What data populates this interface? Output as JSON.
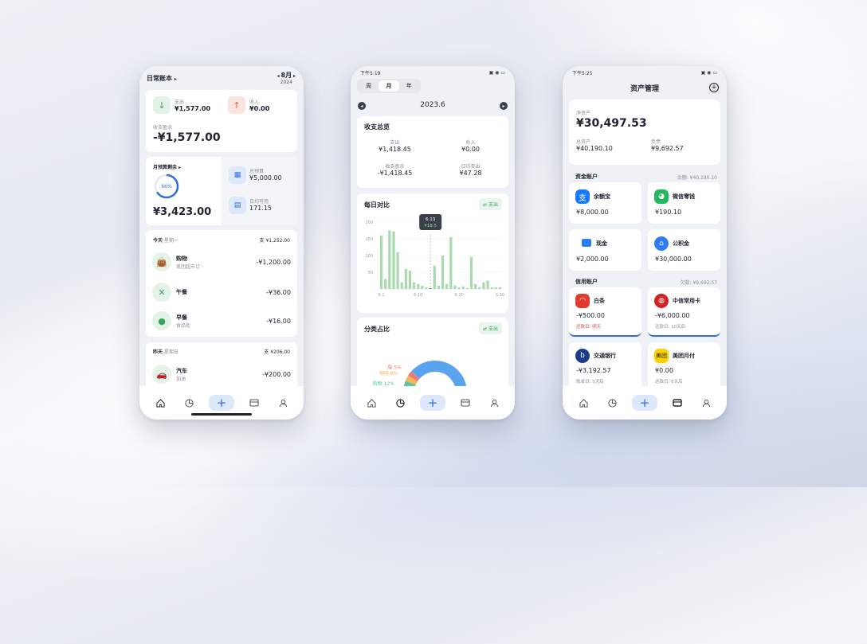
{
  "phone1": {
    "title": "日常账本",
    "month": "8月",
    "year": "2024",
    "expense_label": "支出",
    "expense": "¥1,577.00",
    "income_label": "收入",
    "income": "¥0.00",
    "balance_label": "收支盈余",
    "balance": "-¥1,577.00",
    "budget_label": "月预算剩余",
    "budget_percent": "66%",
    "budget_left": "¥3,423.00",
    "total_budget_label": "总预算",
    "total_budget": "¥5,000.00",
    "daily_label": "日均可用",
    "daily": "171.15",
    "today_label": "今天",
    "today_weekday": "星期一",
    "today_total": "¥1,252.00",
    "today_items": [
      {
        "name": "购物",
        "sub": "美团超市订",
        "amount": "-¥1,200.00"
      },
      {
        "name": "午餐",
        "sub": "",
        "amount": "-¥36.00"
      },
      {
        "name": "早餐",
        "sub": "食品街",
        "amount": "-¥16.00"
      }
    ],
    "yesterday_label": "昨天",
    "yesterday_weekday": "星期日",
    "yesterday_total": "¥206.00",
    "yesterday_items": [
      {
        "name": "汽车",
        "sub": "加油",
        "amount": "-¥200.00"
      }
    ]
  },
  "phone2": {
    "time": "下午5:19",
    "period_tabs": [
      "周",
      "月",
      "年"
    ],
    "period": "2023.6",
    "summary_title": "收支总览",
    "expense_label": "支出",
    "expense": "¥1,418.45",
    "income_label": "收入",
    "income": "¥0.00",
    "balance_label": "收支盈余",
    "balance": "-¥1,418.45",
    "daily_label": "日均支出",
    "daily": "¥47.28",
    "daily_title": "每日对比",
    "toggle": "支出",
    "tooltip_date": "6.13",
    "tooltip_value": "¥18.5",
    "category_title": "分类占比",
    "category_toggle": "支出",
    "chart_data": {
      "type": "bar",
      "y_ticks": [
        "200",
        "150",
        "100",
        "50"
      ],
      "x_ticks": [
        "6.1",
        "6.10",
        "6.20",
        "6.30"
      ],
      "ylim": [
        0,
        200
      ],
      "values": [
        160,
        30,
        175,
        172,
        110,
        20,
        60,
        55,
        20,
        15,
        10,
        5,
        2,
        70,
        10,
        100,
        15,
        155,
        10,
        5,
        8,
        3,
        95,
        15,
        5,
        20,
        25,
        5,
        5,
        5
      ],
      "highlight_index": 12,
      "pie": [
        {
          "name": "购物",
          "value": 12,
          "label": "购物 12%",
          "color": "#5cc49a"
        },
        {
          "name": "咖啡",
          "value": 6,
          "label": "咖啡 6%",
          "color": "#f3b65a"
        },
        {
          "name": "每",
          "value": 5,
          "label": "每 5%",
          "color": "#f07a72"
        },
        {
          "name": "other",
          "value": 77,
          "color": "#5aa3ee"
        }
      ]
    }
  },
  "phone3": {
    "time": "下午5:25",
    "title": "资产管理",
    "net_label": "净资产",
    "net": "¥30,497.53",
    "total_label": "总资产",
    "total": "¥40,190.10",
    "debt_label": "负债",
    "debt": "¥9,692.57",
    "fund_section": "资金账户",
    "fund_total": "余额: ¥40,190.10",
    "funds": [
      {
        "name": "余额宝",
        "amount": "¥8,000.00",
        "color": "#1677ff",
        "icon": "alipay-icon"
      },
      {
        "name": "微信零钱",
        "amount": "¥190.10",
        "color": "#22b85e",
        "icon": "wechat-icon"
      },
      {
        "name": "现金",
        "amount": "¥2,000.00",
        "color": "#2d7cf6",
        "icon": "wallet-icon"
      },
      {
        "name": "公积金",
        "amount": "¥30,000.00",
        "color": "#2d7cf6",
        "icon": "house-icon"
      }
    ],
    "credit_section": "信用账户",
    "credit_total": "欠款: ¥9,692.57",
    "credits": [
      {
        "name": "白条",
        "amount": "-¥500.00",
        "note": "还款日: 明天",
        "note_color": "#e04848",
        "color": "#e23b2e",
        "icon": "baitiao-icon"
      },
      {
        "name": "中信常用卡",
        "amount": "-¥6,000.00",
        "note": "还款日: 10天后",
        "note_color": "#8a8f99",
        "color": "#d32222",
        "icon": "citic-icon"
      },
      {
        "name": "交通银行",
        "amount": "-¥3,192.57",
        "note": "账单日: 5天后",
        "note_color": "#8a8f99",
        "color": "#1a3c8a",
        "icon": "bocom-icon"
      },
      {
        "name": "美团月付",
        "amount": "¥0.00",
        "note": "还款日: 6天后",
        "note_color": "#8a8f99",
        "color": "#ffd100",
        "icon": "meituan-icon"
      }
    ]
  }
}
